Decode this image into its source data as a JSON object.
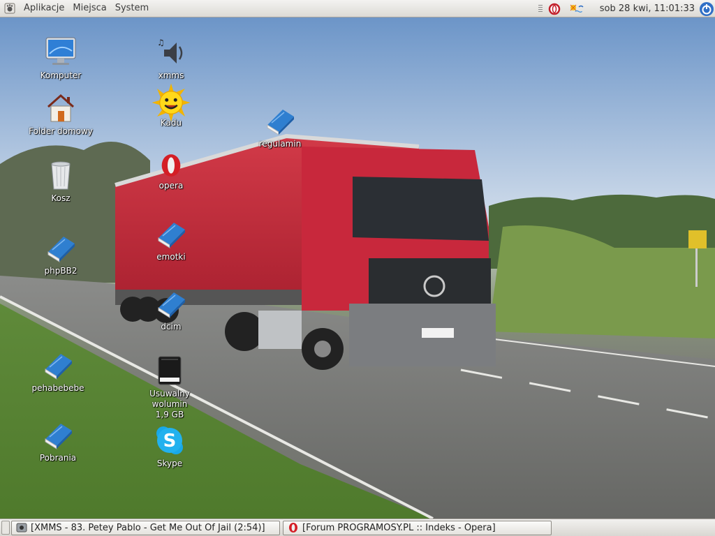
{
  "top_panel": {
    "menus": [
      "Aplikacje",
      "Miejsca",
      "System"
    ],
    "clock": "sob 28 kwi, 11:01:33",
    "tray_icons": [
      "opera-mail-icon",
      "network-weather-icon"
    ]
  },
  "desktop": {
    "icons": [
      {
        "label": "Komputer",
        "icon": "computer-icon"
      },
      {
        "label": "Folder domowy",
        "icon": "home-folder-icon"
      },
      {
        "label": "Kosz",
        "icon": "trash-icon"
      },
      {
        "label": "phpBB2",
        "icon": "book-icon"
      },
      {
        "label": "pehabebebe",
        "icon": "book-icon"
      },
      {
        "label": "Pobrania",
        "icon": "book-icon"
      },
      {
        "label": "xmms",
        "icon": "speaker-icon"
      },
      {
        "label": "Kadu",
        "icon": "sun-icon"
      },
      {
        "label": "opera",
        "icon": "opera-icon"
      },
      {
        "label": "emotki",
        "icon": "book-icon"
      },
      {
        "label": "dcim",
        "icon": "book-icon"
      },
      {
        "label": "Usuwalny wolumin",
        "label2": "1,9 GB",
        "icon": "removable-drive-icon"
      },
      {
        "label": "Skype",
        "icon": "skype-icon"
      },
      {
        "label": "regulamin",
        "icon": "book-icon"
      }
    ]
  },
  "taskbar": {
    "tasks": [
      {
        "title": "[XMMS - 83. Petey Pablo - Get Me Out Of Jail (2:54)]",
        "icon": "xmms-icon"
      },
      {
        "title": "[Forum PROGRAMOSY.PL :: Indeks - Opera]",
        "icon": "opera-icon"
      }
    ]
  },
  "colors": {
    "panel": "#dcdad5",
    "book_blue": "#2f7fd0",
    "truck_red": "#c8283c"
  }
}
